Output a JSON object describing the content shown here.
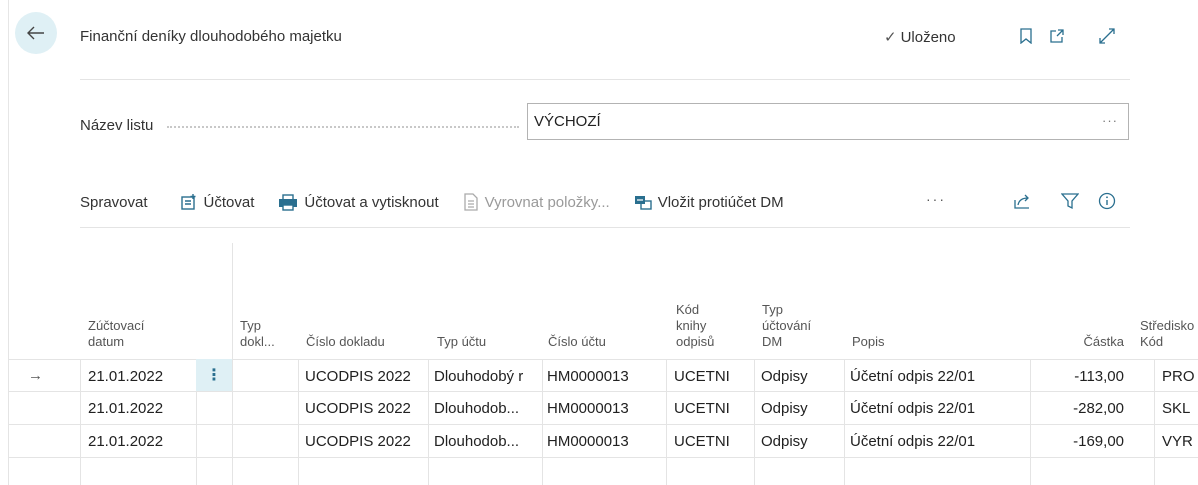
{
  "header": {
    "title": "Finanční deníky dlouhodobého majetku",
    "status": "Uloženo"
  },
  "batch": {
    "label": "Název listu",
    "value": "VÝCHOZÍ",
    "more": "···"
  },
  "toolbar": {
    "manage": "Spravovat",
    "post": "Účtovat",
    "post_print": "Účtovat a vytisknout",
    "apply_entries": "Vyrovnat položky...",
    "insert_balancing": "Vložit protiúčet DM",
    "more": "···"
  },
  "table": {
    "headers": {
      "posting_date": [
        "Zúčtovací",
        "datum"
      ],
      "doc_type": [
        "Typ",
        "dokl..."
      ],
      "doc_no": [
        "Číslo dokladu"
      ],
      "account_type": [
        "Typ účtu"
      ],
      "account_no": [
        "Číslo účtu"
      ],
      "depr_book": [
        "Kód",
        "knihy",
        "odpisů"
      ],
      "fa_posting_type": [
        "Typ",
        "účtování",
        "DM"
      ],
      "description": [
        "Popis"
      ],
      "amount": [
        "Částka"
      ],
      "dept": [
        "Středisko",
        "Kód"
      ]
    },
    "rows": [
      {
        "date": "21.01.2022",
        "doc_type": "",
        "doc_no": "UCODPIS 2022",
        "account_type": "Dlouhodobý r",
        "account_no": "HM0000013",
        "book": "UCETNI",
        "posting_type": "Odpisy",
        "description": "Účetní odpis 22/01",
        "amount": "-113,00",
        "dept": "PRO"
      },
      {
        "date": "21.01.2022",
        "doc_type": "",
        "doc_no": "UCODPIS 2022",
        "account_type": "Dlouhodob...",
        "account_no": "HM0000013",
        "book": "UCETNI",
        "posting_type": "Odpisy",
        "description": "Účetní odpis 22/01",
        "amount": "-282,00",
        "dept": "SKL"
      },
      {
        "date": "21.01.2022",
        "doc_type": "",
        "doc_no": "UCODPIS 2022",
        "account_type": "Dlouhodob...",
        "account_no": "HM0000013",
        "book": "UCETNI",
        "posting_type": "Odpisy",
        "description": "Účetní odpis 22/01",
        "amount": "-169,00",
        "dept": "VYR"
      }
    ]
  }
}
